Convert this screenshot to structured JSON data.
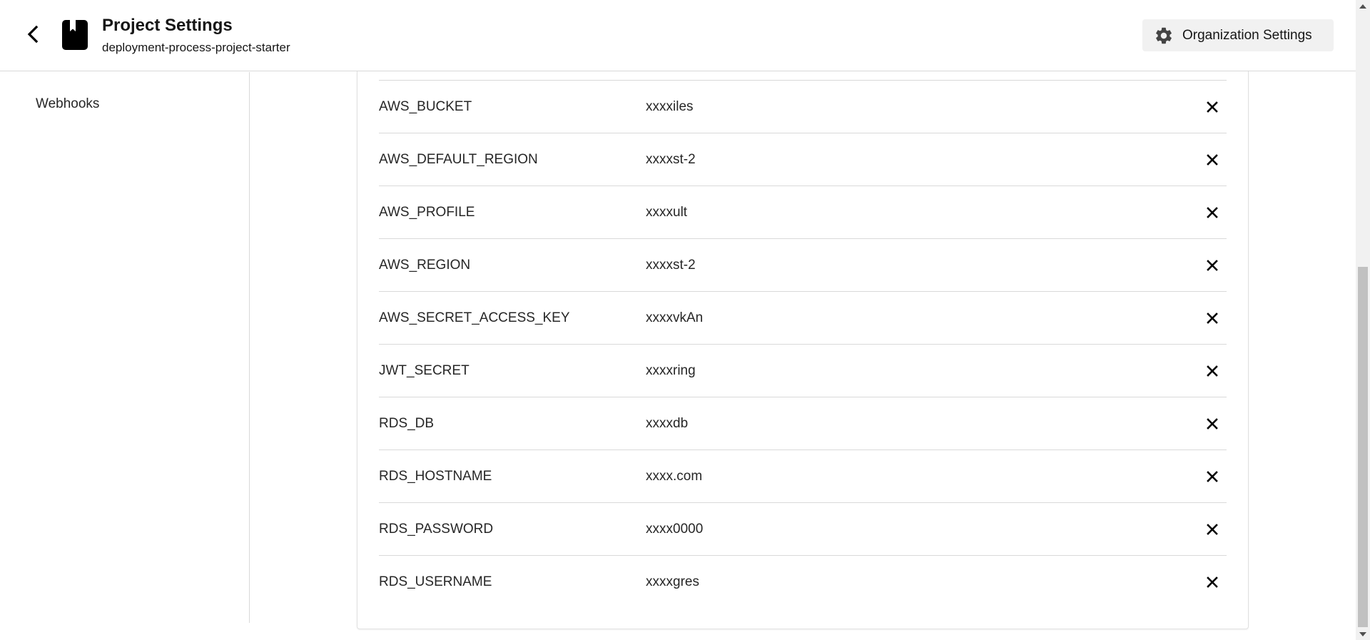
{
  "header": {
    "title": "Project Settings",
    "subtitle": "deployment-process-project-starter",
    "back_icon": "chevron-left-icon",
    "project_icon": "book-icon",
    "org_button_label": "Organization Settings",
    "org_button_icon": "gear-icon"
  },
  "sidebar": {
    "items": [
      {
        "label": "Webhooks"
      }
    ]
  },
  "env_vars": {
    "rows": [
      {
        "name": "AWS_BUCKET",
        "value": "xxxxiles"
      },
      {
        "name": "AWS_DEFAULT_REGION",
        "value": "xxxxst-2"
      },
      {
        "name": "AWS_PROFILE",
        "value": "xxxxult"
      },
      {
        "name": "AWS_REGION",
        "value": "xxxxst-2"
      },
      {
        "name": "AWS_SECRET_ACCESS_KEY",
        "value": "xxxxvkAn"
      },
      {
        "name": "JWT_SECRET",
        "value": "xxxxring"
      },
      {
        "name": "RDS_DB",
        "value": "xxxxdb"
      },
      {
        "name": "RDS_HOSTNAME",
        "value": "xxxx.com"
      },
      {
        "name": "RDS_PASSWORD",
        "value": "xxxx0000"
      },
      {
        "name": "RDS_USERNAME",
        "value": "xxxxgres"
      }
    ],
    "delete_icon": "close-icon"
  },
  "colors": {
    "text": "#161616",
    "divider": "#d9d9d9",
    "button_bg": "#f1f1f1"
  }
}
